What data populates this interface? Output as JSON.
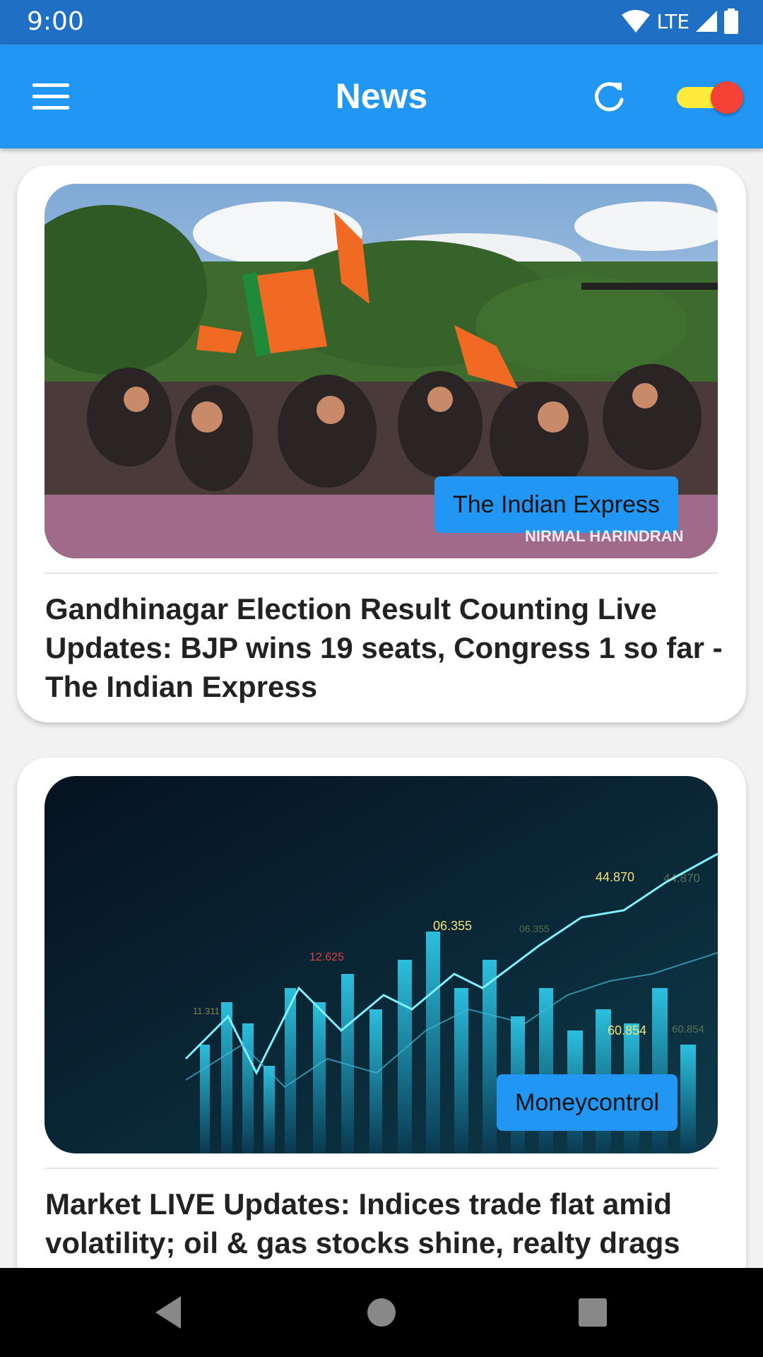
{
  "status_bar": {
    "time": "9:00",
    "network": "LTE"
  },
  "app_bar": {
    "title": "News",
    "theme_toggle_on": true
  },
  "articles": [
    {
      "source": "The Indian Express",
      "photo_credit": "NIRMAL HARINDRAN",
      "headline": "Gandhinagar Election Result Counting Live Updates: BJP wins 19 seats, Congress 1 so far - The Indian Express"
    },
    {
      "source": "Moneycontrol",
      "chart_labels": [
        "44.870",
        "06.355",
        "12.625",
        "60.854",
        "11.311",
        "44.870",
        "06.355",
        "60.854"
      ],
      "headline": "Market LIVE Updates: Indices trade flat amid volatility; oil & gas stocks shine, realty drags"
    }
  ],
  "colors": {
    "status_bar": "#1f6fc4",
    "app_bar": "#2196f3",
    "toggle_track": "#ffeb3b",
    "toggle_thumb": "#f44336",
    "badge": "#2196f3"
  },
  "icons": {
    "menu": "menu-icon",
    "refresh": "refresh-icon",
    "back": "back-icon",
    "home": "home-icon",
    "recents": "recents-icon"
  }
}
